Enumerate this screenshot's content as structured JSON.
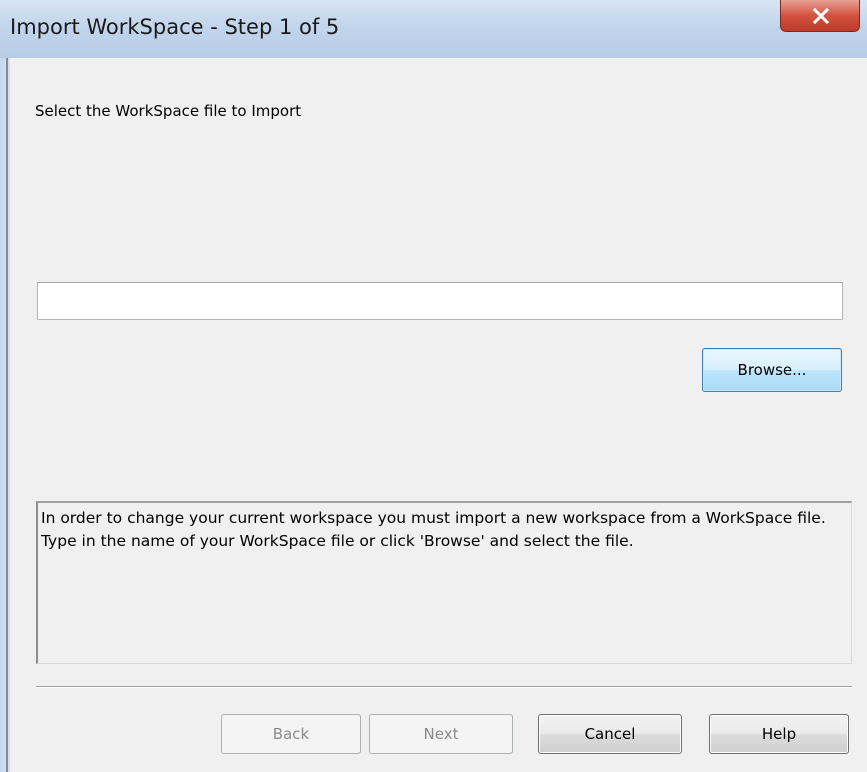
{
  "window": {
    "title": "Import WorkSpace - Step 1 of 5",
    "close_icon": "close-icon"
  },
  "main": {
    "heading": "Select the WorkSpace file to Import",
    "file_input": {
      "value": "",
      "placeholder": ""
    },
    "browse_label": "Browse...",
    "info_text": "In order to change your current workspace you must import a new workspace from a WorkSpace file. Type in the name of your WorkSpace file or click 'Browse' and select the file."
  },
  "footer": {
    "back_label": "Back",
    "next_label": "Next",
    "cancel_label": "Cancel",
    "help_label": "Help"
  },
  "colors": {
    "titlebar": "#c2d5ec",
    "close_button": "#d2533f",
    "browse_accent": "#bee6fd",
    "background": "#f0f0f0"
  }
}
